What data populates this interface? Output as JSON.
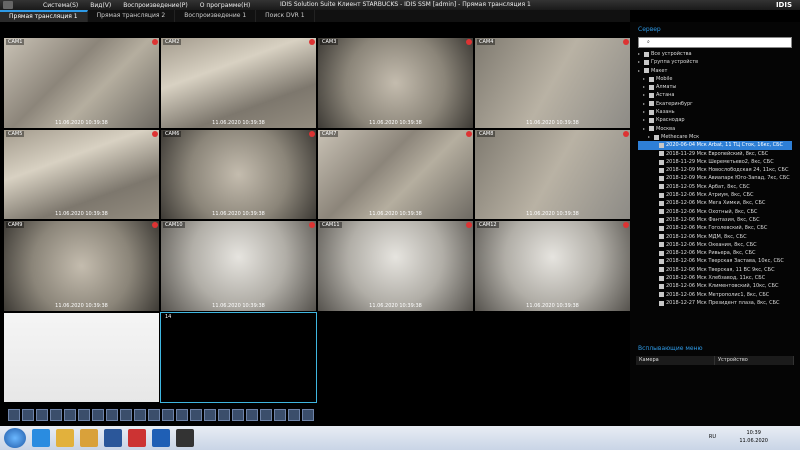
{
  "window": {
    "title": "IDIS Solution Suite Клиент STARBUCKS - IDIS SSM [admin] - Прямая трансляция 1",
    "brand": "IDIS"
  },
  "menu": [
    "Система(S)",
    "Вид(V)",
    "Воспроизведение(P)",
    "О программе(H)"
  ],
  "tabs": [
    {
      "label": "Прямая трансляция 1",
      "active": true
    },
    {
      "label": "Прямая трансляция 2",
      "active": false
    },
    {
      "label": "Воспроизведение 1",
      "active": false
    },
    {
      "label": "Поиск DVR 1",
      "active": false
    }
  ],
  "cameras": [
    {
      "label": "CAM1",
      "stamp": "11.06.2020 10:39:38",
      "scene": "store-a"
    },
    {
      "label": "CAM2",
      "stamp": "11.06.2020 10:39:38",
      "scene": "store-b"
    },
    {
      "label": "CAM3",
      "stamp": "11.06.2020 10:39:38",
      "scene": "store-c"
    },
    {
      "label": "CAM4",
      "stamp": "11.06.2020 10:39:38",
      "scene": "store-d"
    },
    {
      "label": "CAM5",
      "stamp": "11.06.2020 10:39:38",
      "scene": "store-b"
    },
    {
      "label": "CAM6",
      "stamp": "11.06.2020 10:39:38",
      "scene": "store-c"
    },
    {
      "label": "CAM7",
      "stamp": "11.06.2020 10:39:38",
      "scene": "store-a"
    },
    {
      "label": "CAM8",
      "stamp": "11.06.2020 10:39:38",
      "scene": "store-d"
    },
    {
      "label": "CAM9",
      "stamp": "11.06.2020 10:39:38",
      "scene": "store-c"
    },
    {
      "label": "CAM10",
      "stamp": "11.06.2020 10:39:38",
      "scene": "shelves"
    },
    {
      "label": "CAM11",
      "stamp": "11.06.2020 10:39:38",
      "scene": "shelves"
    },
    {
      "label": "CAM12",
      "stamp": "11.06.2020 10:39:38",
      "scene": "shelves"
    },
    {
      "label": "",
      "stamp": "",
      "scene": "document"
    },
    {
      "label": "14",
      "stamp": "",
      "scene": "empty-selected"
    },
    {
      "label": "",
      "stamp": "",
      "scene": "empty"
    },
    {
      "label": "",
      "stamp": "",
      "scene": "empty"
    }
  ],
  "right_panel": {
    "header": "Сервер",
    "search_placeholder": "",
    "tree": [
      {
        "label": "Все устройства",
        "depth": 0
      },
      {
        "label": "Группа устройств",
        "depth": 0
      },
      {
        "label": "Макет",
        "depth": 0
      },
      {
        "label": "Mobile",
        "depth": 1
      },
      {
        "label": "Алматы",
        "depth": 1
      },
      {
        "label": "Астана",
        "depth": 1
      },
      {
        "label": "Екатеринбург",
        "depth": 1
      },
      {
        "label": "Казань",
        "depth": 1
      },
      {
        "label": "Краснодар",
        "depth": 1
      },
      {
        "label": "Москва",
        "depth": 1
      },
      {
        "label": "Metheсare Мск",
        "depth": 2
      },
      {
        "label": "2020-06-04 Мск Arbat, 11 ТЦ Сток, 16кс, СБС",
        "depth": 3,
        "selected": true
      },
      {
        "label": "2018-11-29 Мск Европейский, 8кс, СБС",
        "depth": 3
      },
      {
        "label": "2018-11-29 Мск Шереметьево2, 8кс, СБС",
        "depth": 3
      },
      {
        "label": "2018-12-09 Мск Новослободская 24, 11кс, СБС",
        "depth": 3
      },
      {
        "label": "2018-12-09 Мск Авиапарк Юго-Запад, 7кс, СБС",
        "depth": 3
      },
      {
        "label": "2018-12-05 Мск Арбат, 8кс, СБС",
        "depth": 3
      },
      {
        "label": "2018-12-06 Мск Атриум, 8кс, СБС",
        "depth": 3
      },
      {
        "label": "2018-12-06 Мск Мега Химки, 8кс, СБС",
        "depth": 3
      },
      {
        "label": "2018-12-06 Мск Охотный, 8кс, СБС",
        "depth": 3
      },
      {
        "label": "2018-12-06 Мск Фантазия, 8кс, СБС",
        "depth": 3
      },
      {
        "label": "2018-12-06 Мск Гоголевский, 8кс, СБС",
        "depth": 3
      },
      {
        "label": "2018-12-06 Мск МДМ, 8кс, СБС",
        "depth": 3
      },
      {
        "label": "2018-12-06 Мск Океания, 8кс, СБС",
        "depth": 3
      },
      {
        "label": "2018-12-06 Мск Ривьера, 8кс, СБС",
        "depth": 3
      },
      {
        "label": "2018-12-06 Мск Тверская Застава, 10кс, СБС",
        "depth": 3
      },
      {
        "label": "2018-12-06 Мск Тверская, 11 ВС 9кс, СБС",
        "depth": 3
      },
      {
        "label": "2018-12-06 Мск Хлебзавод, 11кс, СБС",
        "depth": 3
      },
      {
        "label": "2018-12-06 Мск Климентовский, 10кс, СБС",
        "depth": 3
      },
      {
        "label": "2018-12-06 Мск Метрополис1, 8кс, СБС",
        "depth": 3
      },
      {
        "label": "2018-12-27 Мск Президент плаза, 8кс, СБС",
        "depth": 3
      }
    ],
    "popup_header": "Всплывающие меню",
    "columns": [
      "Камера",
      "Устройство"
    ]
  },
  "taskbar": {
    "lang": "RU",
    "time": "10:39",
    "date": "11.06.2020",
    "items": [
      "start",
      "ie-icon",
      "chrome-icon",
      "explorer-icon",
      "word-icon",
      "idis-icon",
      "teamviewer-icon",
      "browser-icon"
    ]
  }
}
